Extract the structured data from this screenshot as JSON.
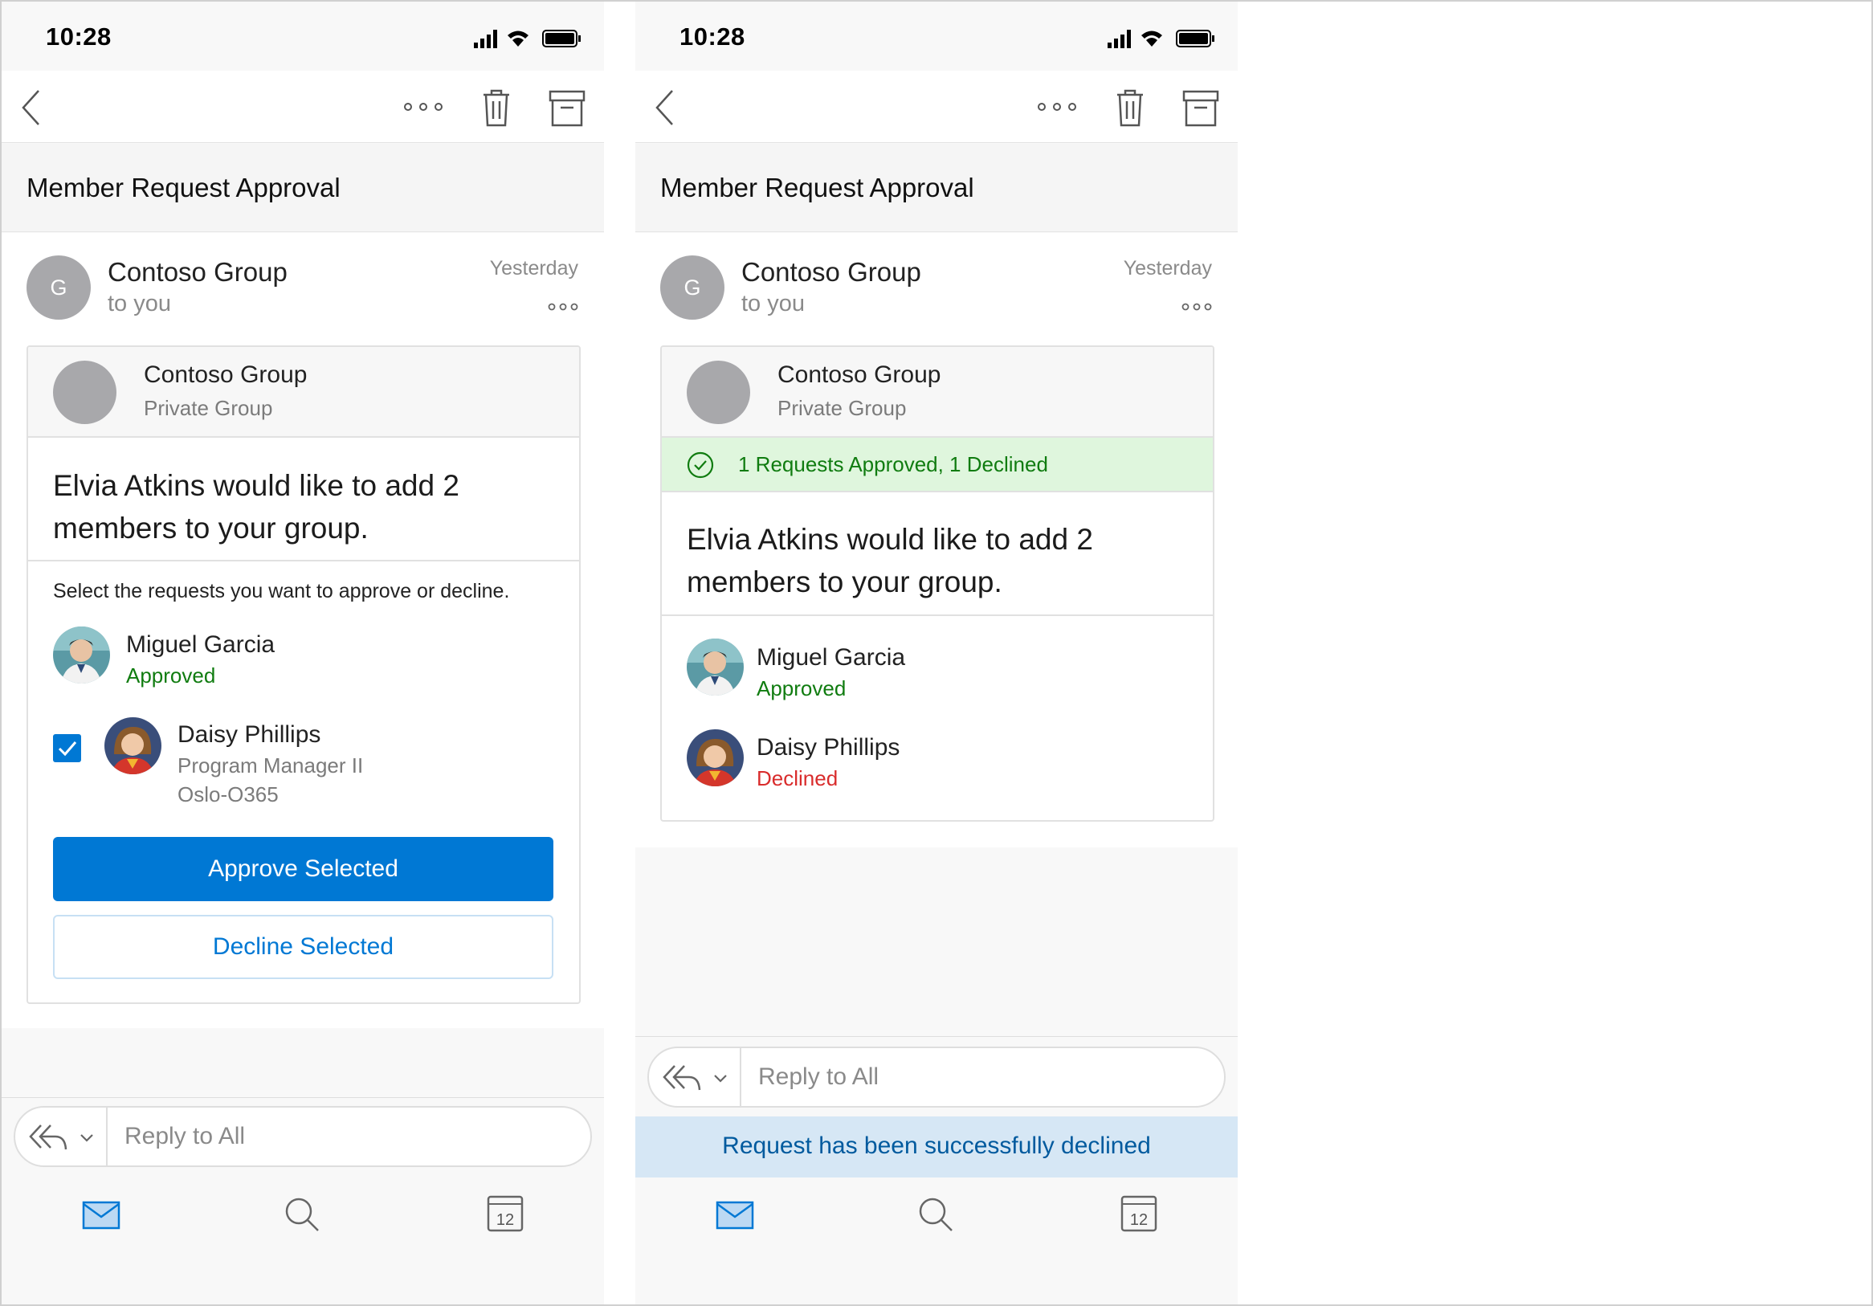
{
  "status_bar": {
    "time": "10:28"
  },
  "email": {
    "subject": "Member Request Approval",
    "sender_initial": "G",
    "sender_name": "Contoso Group",
    "recipient": "to you",
    "date": "Yesterday"
  },
  "card": {
    "group_name": "Contoso Group",
    "group_type": "Private Group",
    "headline": "Elvia Atkins would like to add 2 members to your group.",
    "instructions": "Select the requests you want to approve or decline.",
    "result_banner": "1 Requests Approved, 1 Declined"
  },
  "members": [
    {
      "name": "Miguel Garcia",
      "status": "Approved"
    },
    {
      "name": "Daisy Phillips",
      "title": "Program Manager II",
      "office": "Oslo-O365",
      "status": "Declined"
    }
  ],
  "buttons": {
    "approve": "Approve Selected",
    "decline": "Decline Selected"
  },
  "reply": {
    "placeholder": "Reply to All"
  },
  "toast": "Request has been successfully declined",
  "tabbar": {
    "calendar_day": "12"
  },
  "colors": {
    "accent": "#0078d4",
    "approved": "#107c10",
    "declined": "#d92c2c",
    "banner_bg": "#dff6dd",
    "toast_bg": "#d6e7f5"
  },
  "icons": [
    "back-chevron-icon",
    "more-icon",
    "trash-icon",
    "archive-icon",
    "reply-all-icon",
    "chevron-down-icon",
    "mail-icon",
    "search-icon",
    "calendar-icon",
    "check-circle-icon",
    "checkbox-checked-icon"
  ]
}
